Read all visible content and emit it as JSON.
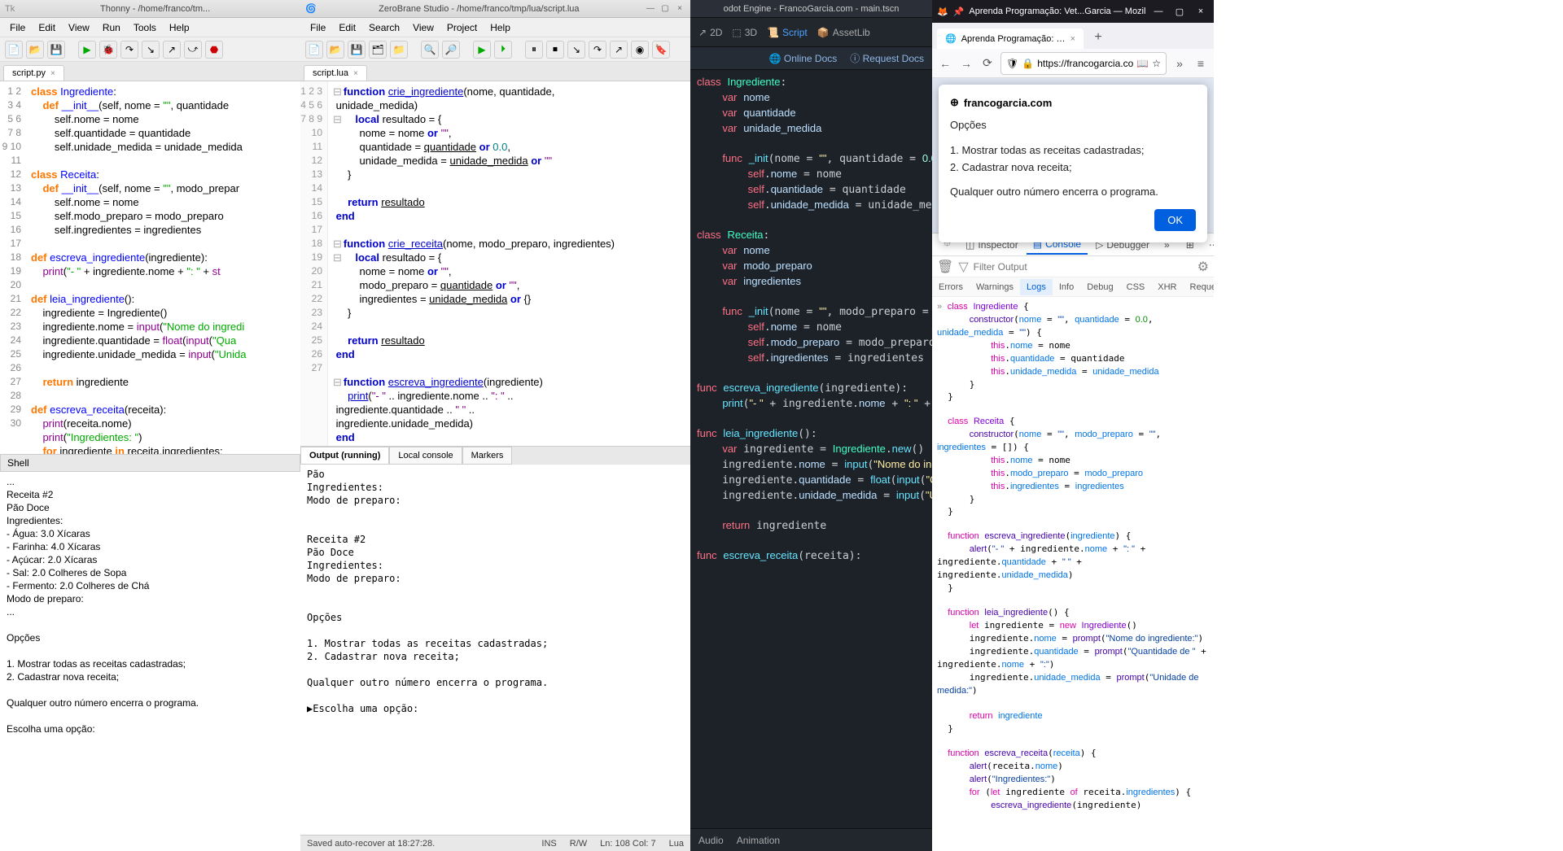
{
  "thonny": {
    "title": "Thonny - /home/franco/tm...",
    "menu": [
      "File",
      "Edit",
      "View",
      "Run",
      "Tools",
      "Help"
    ],
    "tab": "script.py",
    "lines_start": 1,
    "lines_end": 30,
    "shell_title": "Shell",
    "shell_output": "...\nReceita #2\nPão Doce\nIngredientes:\n- Água: 3.0 Xícaras\n- Farinha: 4.0 Xícaras\n- Açúcar: 2.0 Xícaras\n- Sal: 2.0 Colheres de Sopa\n- Fermento: 2.0 Colheres de Chá\nModo de preparo:\n...\n\nOpções\n\n1. Mostrar todas as receitas cadastradas;\n2. Cadastrar nova receita;\n\nQualquer outro número encerra o programa.\n\nEscolha uma opção:"
  },
  "zerobrane": {
    "title": "ZeroBrane Studio - /home/franco/tmp/lua/script.lua",
    "menu": [
      "File",
      "Edit",
      "Search",
      "View",
      "Project",
      "Help"
    ],
    "tab": "script.lua",
    "lines_start": 1,
    "lines_end": 27,
    "bottom_tabs": {
      "output": "Output (running)",
      "local": "Local console",
      "markers": "Markers"
    },
    "console": "Pão\nIngredientes:\nModo de preparo:\n\n\nReceita #2\nPão Doce\nIngredientes:\nModo de preparo:\n\n\nOpções\n\n1. Mostrar todas as receitas cadastradas;\n2. Cadastrar nova receita;\n\nQualquer outro número encerra o programa.\n\n▶Escolha uma opção:",
    "status": {
      "save": "Saved auto-recover at 18:27:28.",
      "ins": "INS",
      "rw": "R/W",
      "pos": "Ln: 108 Col: 7",
      "lang": "Lua"
    }
  },
  "godot": {
    "title": "odot Engine - FrancoGarcia.com - main.tscn",
    "top": {
      "2d": "2D",
      "3d": "3D",
      "script": "Script",
      "assetlib": "AssetLib"
    },
    "docs": {
      "online": "Online Docs",
      "request": "Request Docs"
    },
    "bottom": {
      "audio": "Audio",
      "anim": "Animation"
    }
  },
  "firefox": {
    "title": "Aprenda Programação: Vet...Garcia — Mozilla Firefox",
    "tab": "Aprenda Programação: Vetor",
    "url": "https://francogarcia.co",
    "modal": {
      "domain": "francogarcia.com",
      "heading": "Opções",
      "item1": "1. Mostrar todas as receitas cadastradas;",
      "item2": "2. Cadastrar nova receita;",
      "footer": "Qualquer outro número encerra o programa.",
      "ok": "OK"
    },
    "devtools": {
      "tabs": {
        "inspector": "Inspector",
        "console": "Console",
        "debugger": "Debugger"
      },
      "filter_placeholder": "Filter Output",
      "subtabs": [
        "Errors",
        "Warnings",
        "Logs",
        "Info",
        "Debug",
        "CSS",
        "XHR",
        "Requests"
      ]
    }
  }
}
